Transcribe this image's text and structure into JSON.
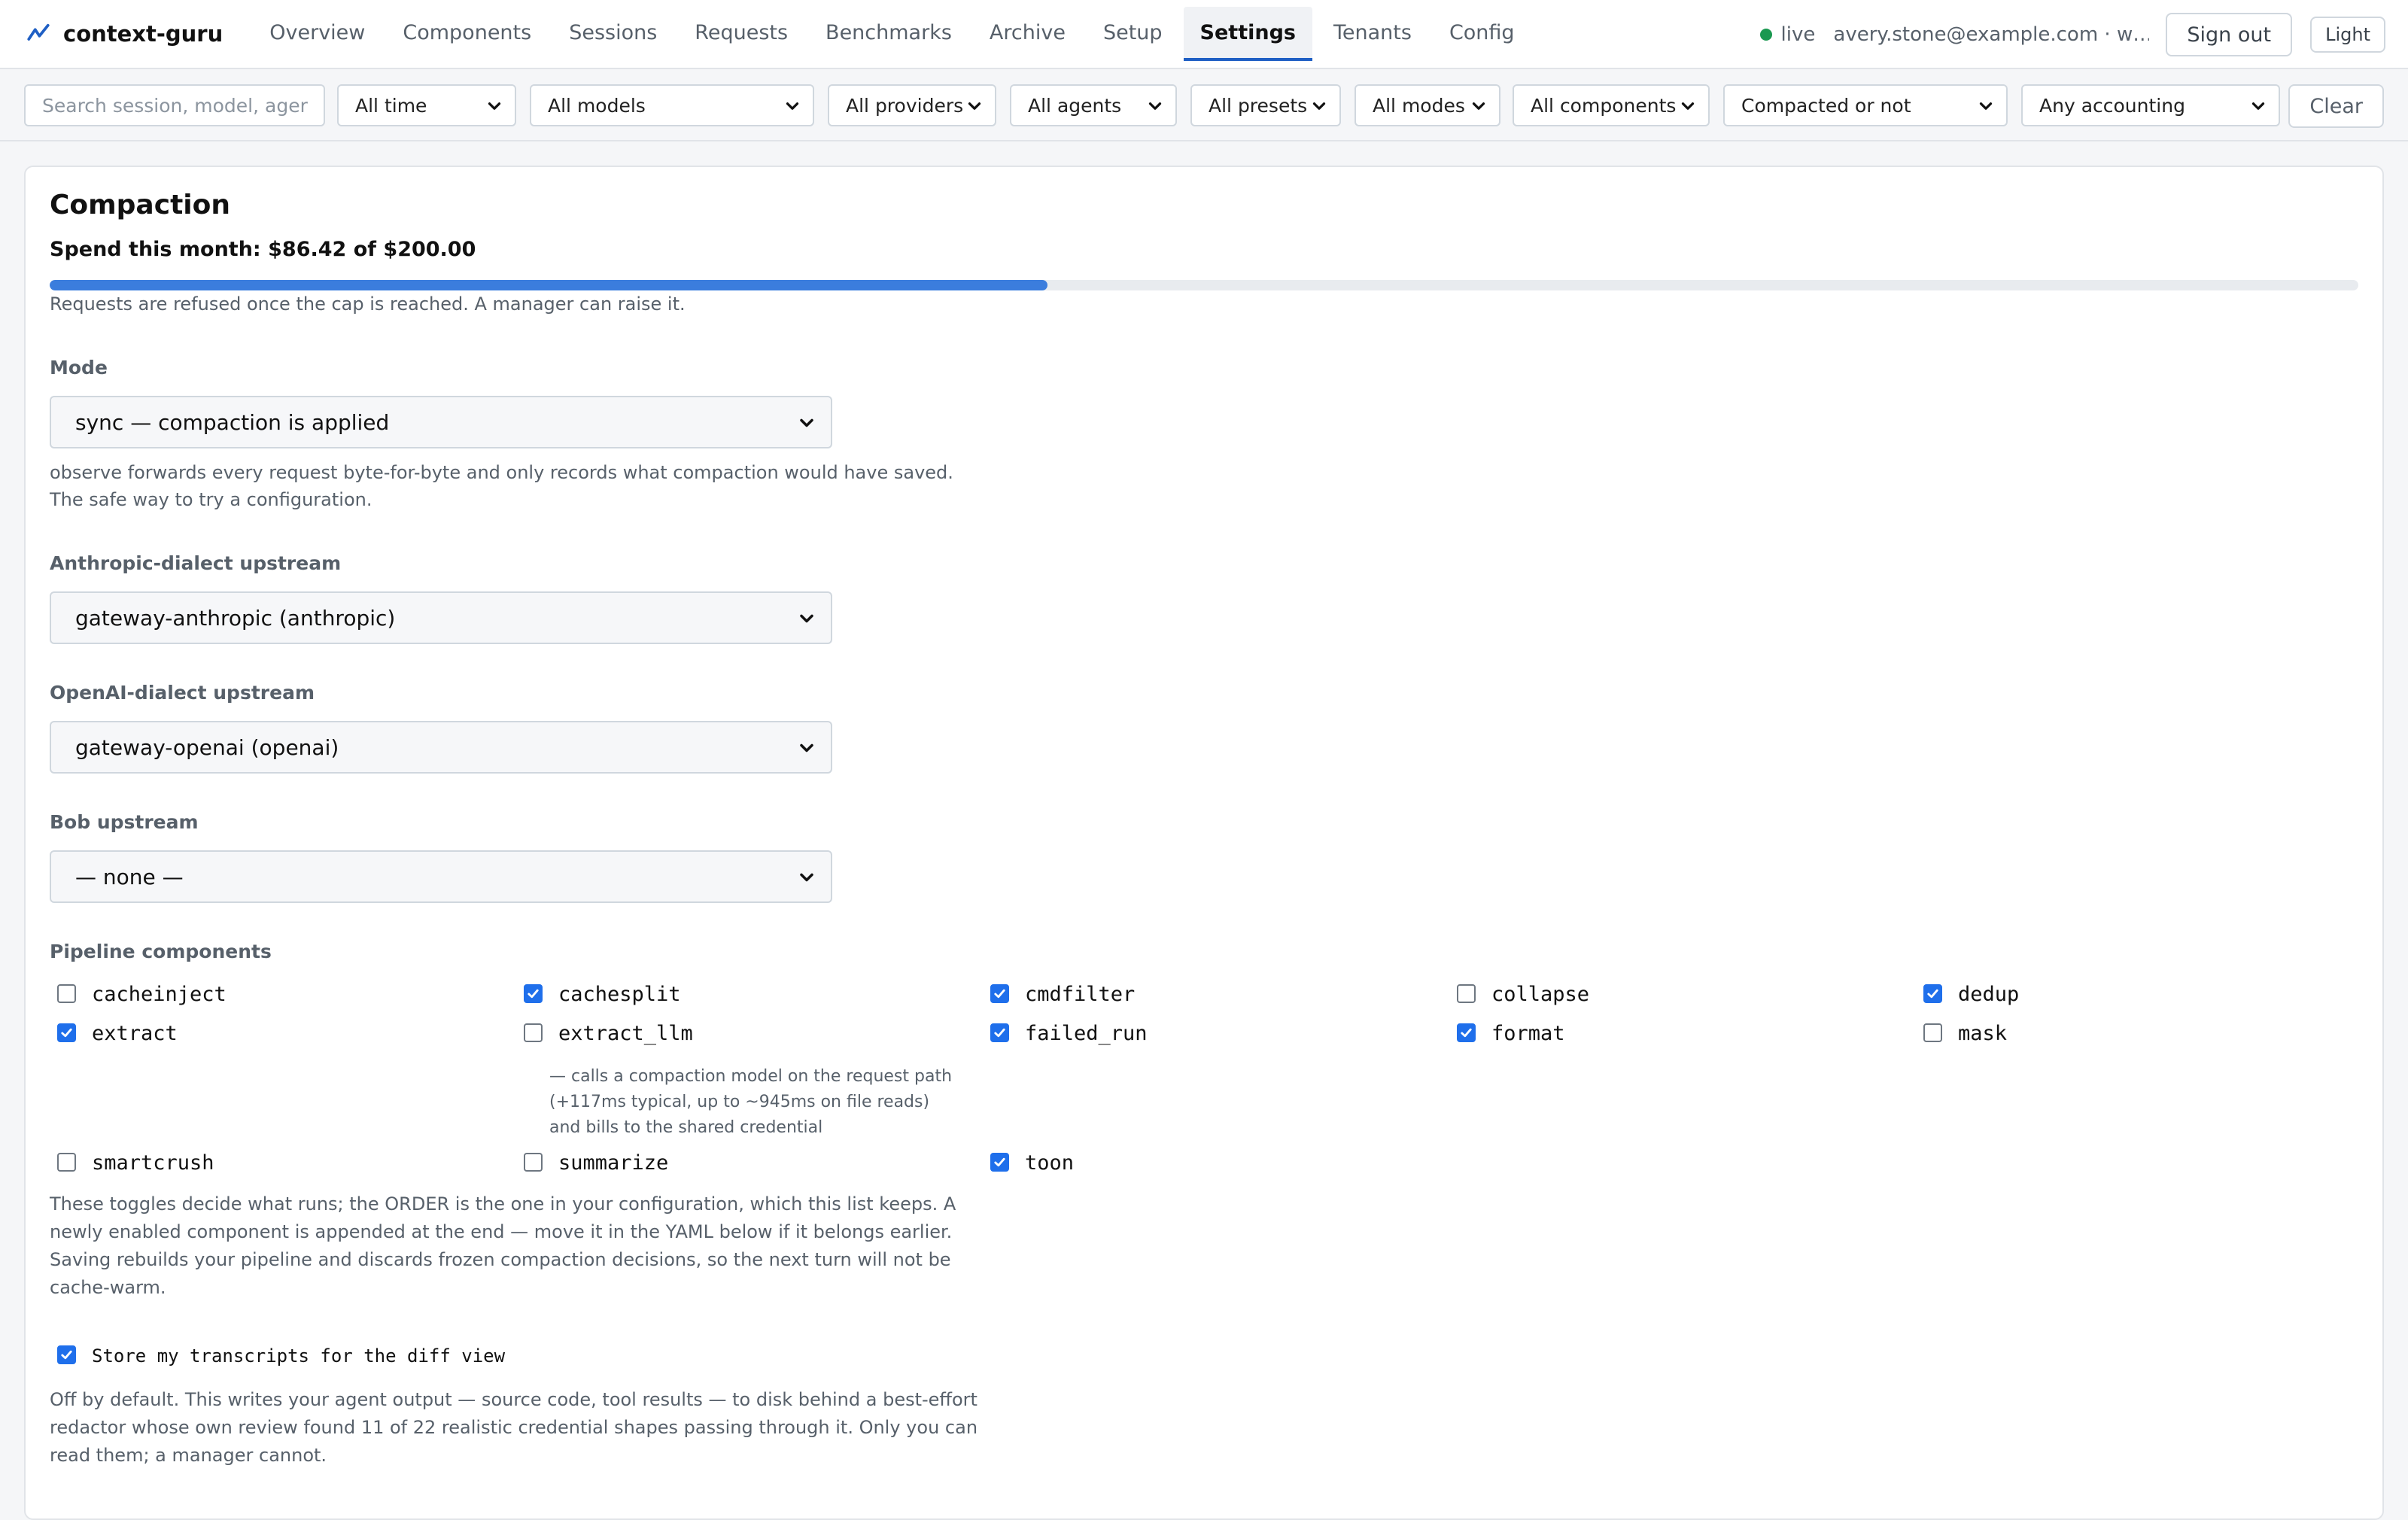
{
  "app": {
    "name": "context-guru"
  },
  "nav": {
    "items": [
      {
        "label": "Overview"
      },
      {
        "label": "Components"
      },
      {
        "label": "Sessions"
      },
      {
        "label": "Requests"
      },
      {
        "label": "Benchmarks"
      },
      {
        "label": "Archive"
      },
      {
        "label": "Setup"
      },
      {
        "label": "Settings",
        "active": true
      },
      {
        "label": "Tenants"
      },
      {
        "label": "Config"
      }
    ]
  },
  "status": {
    "live_label": "live",
    "user": "avery.stone@example.com · w…",
    "live_color": "#1a9850"
  },
  "header_buttons": {
    "sign_out": "Sign out",
    "theme": "Light"
  },
  "filters": {
    "search_placeholder": "Search session, model, ager",
    "time": "All time",
    "models": "All models",
    "providers": "All providers",
    "agents": "All agents",
    "presets": "All presets",
    "modes": "All modes",
    "components": "All components",
    "compacted": "Compacted or not",
    "accounting": "Any accounting",
    "clear": "Clear"
  },
  "compaction": {
    "title": "Compaction",
    "spend": "Spend this month: $86.42 of $200.00",
    "spend_fraction": 0.4321,
    "cap_note": "Requests are refused once the cap is reached. A manager can raise it.",
    "mode_label": "Mode",
    "mode_value": "sync — compaction is applied",
    "mode_help_1": "observe forwards every request byte-for-byte and only records what compaction would have saved.",
    "mode_help_2": "The safe way to try a configuration.",
    "anthropic_label": "Anthropic-dialect upstream",
    "anthropic_value": "gateway-anthropic (anthropic)",
    "openai_label": "OpenAI-dialect upstream",
    "openai_value": "gateway-openai (openai)",
    "bob_label": "Bob upstream",
    "bob_value": "— none —",
    "pipeline_label": "Pipeline components",
    "components": [
      {
        "name": "cacheinject",
        "checked": false
      },
      {
        "name": "cachesplit",
        "checked": true
      },
      {
        "name": "cmdfilter",
        "checked": true
      },
      {
        "name": "collapse",
        "checked": false
      },
      {
        "name": "dedup",
        "checked": true
      },
      {
        "name": "extract",
        "checked": true
      },
      {
        "name": "extract_llm",
        "checked": false
      },
      {
        "name": "failed_run",
        "checked": true
      },
      {
        "name": "format",
        "checked": true
      },
      {
        "name": "mask",
        "checked": false
      },
      {
        "name": "smartcrush",
        "checked": false
      },
      {
        "name": "summarize",
        "checked": false
      },
      {
        "name": "toon",
        "checked": true
      }
    ],
    "extract_llm_note_1": "— calls a compaction model on the request path",
    "extract_llm_note_2": "(+117ms typical, up to ~945ms on file reads)",
    "extract_llm_note_3": "and bills to the shared credential",
    "order_note_1": "These toggles decide what runs; the ORDER is the one in your configuration, which this list keeps. A",
    "order_note_2": "newly enabled component is appended at the end — move it in the YAML below if it belongs earlier.",
    "order_note_3": "Saving rebuilds your pipeline and discards frozen compaction decisions, so the next turn will not be",
    "order_note_4": "cache-warm.",
    "store_label": "Store my transcripts for the diff view",
    "store_checked": true,
    "store_note_1": "Off by default. This writes your agent output — source code, tool results — to disk behind a best-effort",
    "store_note_2": "redactor whose own review found 11 of 22 realistic credential shapes passing through it. Only you can",
    "store_note_3": "read them; a manager cannot."
  }
}
